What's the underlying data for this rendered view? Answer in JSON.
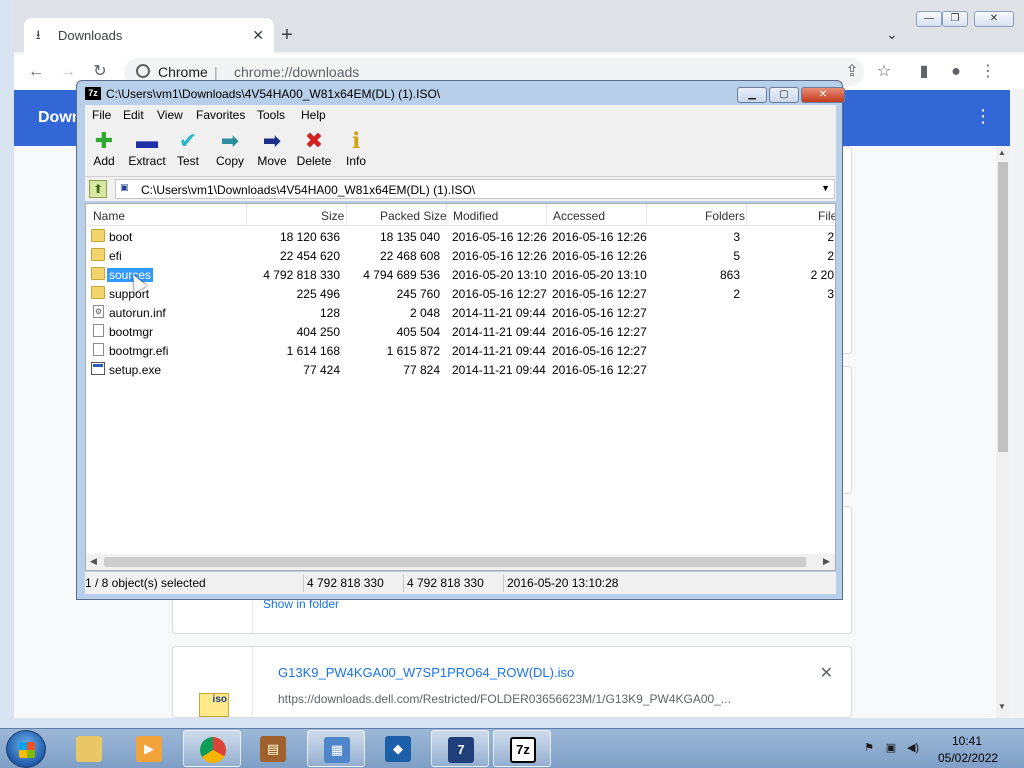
{
  "chrome": {
    "tab_title": "Downloads",
    "new_tab": "+",
    "site_name": "Chrome",
    "url": "chrome://downloads",
    "header_title": "Downloads",
    "show_in_folder": "Show in folder",
    "download2_name": "G13K9_PW4KGA00_W7SP1PRO64_ROW(DL).iso",
    "download2_url": "https://downloads.dell.com/Restricted/FOLDER03656623M/1/G13K9_PW4KGA00_...",
    "file_badge": "iso"
  },
  "sevenzip": {
    "title": "C:\\Users\\vm1\\Downloads\\4V54HA00_W81x64EM(DL) (1).ISO\\",
    "app_icon": "7z",
    "menu": [
      "File",
      "Edit",
      "View",
      "Favorites",
      "Tools",
      "Help"
    ],
    "toolbar": [
      {
        "label": "Add",
        "icon": "plus-icon",
        "color": "#2ea82e"
      },
      {
        "label": "Extract",
        "icon": "minus-icon",
        "color": "#1f2fa8"
      },
      {
        "label": "Test",
        "icon": "check-icon",
        "color": "#29b6c9"
      },
      {
        "label": "Copy",
        "icon": "double-arrow-icon",
        "color": "#2a8f9c"
      },
      {
        "label": "Move",
        "icon": "arrow-right-icon",
        "color": "#1b2e8a"
      },
      {
        "label": "Delete",
        "icon": "x-icon",
        "color": "#d42020"
      },
      {
        "label": "Info",
        "icon": "info-icon",
        "color": "#d4a418"
      }
    ],
    "address": "C:\\Users\\vm1\\Downloads\\4V54HA00_W81x64EM(DL) (1).ISO\\",
    "columns": [
      "Name",
      "Size",
      "Packed Size",
      "Modified",
      "Accessed",
      "Folders",
      "File"
    ],
    "rows": [
      {
        "name": "boot",
        "type": "folder",
        "size": "18 120 636",
        "packed": "18 135 040",
        "modified": "2016-05-16 12:26",
        "accessed": "2016-05-16 12:26",
        "folders": "3",
        "files": "2"
      },
      {
        "name": "efi",
        "type": "folder",
        "size": "22 454 620",
        "packed": "22 468 608",
        "modified": "2016-05-16 12:26",
        "accessed": "2016-05-16 12:26",
        "folders": "5",
        "files": "2"
      },
      {
        "name": "sources",
        "type": "folder",
        "size": "4 792 818 330",
        "packed": "4 794 689 536",
        "modified": "2016-05-20 13:10",
        "accessed": "2016-05-20 13:10",
        "folders": "863",
        "files": "2 20"
      },
      {
        "name": "support",
        "type": "folder",
        "size": "225 496",
        "packed": "245 760",
        "modified": "2016-05-16 12:27",
        "accessed": "2016-05-16 12:27",
        "folders": "2",
        "files": "3"
      },
      {
        "name": "autorun.inf",
        "type": "inf",
        "size": "128",
        "packed": "2 048",
        "modified": "2014-11-21 09:44",
        "accessed": "2016-05-16 12:27",
        "folders": "",
        "files": ""
      },
      {
        "name": "bootmgr",
        "type": "file",
        "size": "404 250",
        "packed": "405 504",
        "modified": "2014-11-21 09:44",
        "accessed": "2016-05-16 12:27",
        "folders": "",
        "files": ""
      },
      {
        "name": "bootmgr.efi",
        "type": "file",
        "size": "1 614 168",
        "packed": "1 615 872",
        "modified": "2014-11-21 09:44",
        "accessed": "2016-05-16 12:27",
        "folders": "",
        "files": ""
      },
      {
        "name": "setup.exe",
        "type": "exe",
        "size": "77 424",
        "packed": "77 824",
        "modified": "2014-11-21 09:44",
        "accessed": "2016-05-16 12:27",
        "folders": "",
        "files": ""
      }
    ],
    "selected_index": 2,
    "status": {
      "selection": "1 / 8 object(s) selected",
      "size": "4 792 818 330",
      "packed": "4 792 818 330",
      "date": "2016-05-20 13:10:28"
    }
  },
  "taskbar": {
    "time": "10:41",
    "date": "05/02/2022",
    "sevenzip_label": "7z"
  }
}
